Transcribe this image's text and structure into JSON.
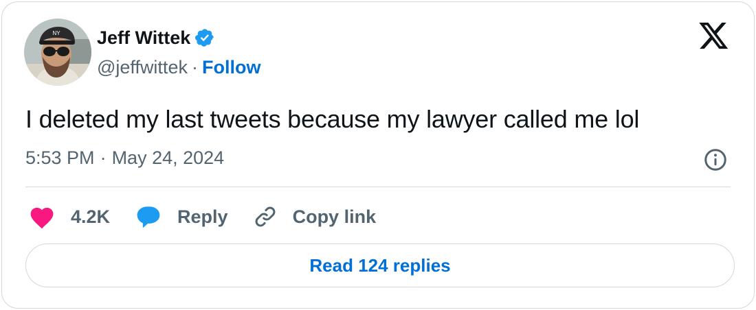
{
  "author": {
    "display_name": "Jeff Wittek",
    "handle": "@jeffwittek",
    "separator": "·",
    "follow_label": "Follow",
    "verified_icon": "verified-badge-icon"
  },
  "tweet": {
    "text": "I deleted my last tweets because my lawyer called me lol",
    "time": "5:53 PM",
    "separator": "·",
    "date": "May 24, 2024"
  },
  "actions": {
    "like_count": "4.2K",
    "reply_label": "Reply",
    "copy_link_label": "Copy link"
  },
  "footer": {
    "read_replies_label": "Read 124 replies"
  },
  "colors": {
    "accent": "#006fd6",
    "verified": "#1d9bf0",
    "like": "#f91880",
    "muted": "#536471",
    "border": "#cfd9de"
  }
}
